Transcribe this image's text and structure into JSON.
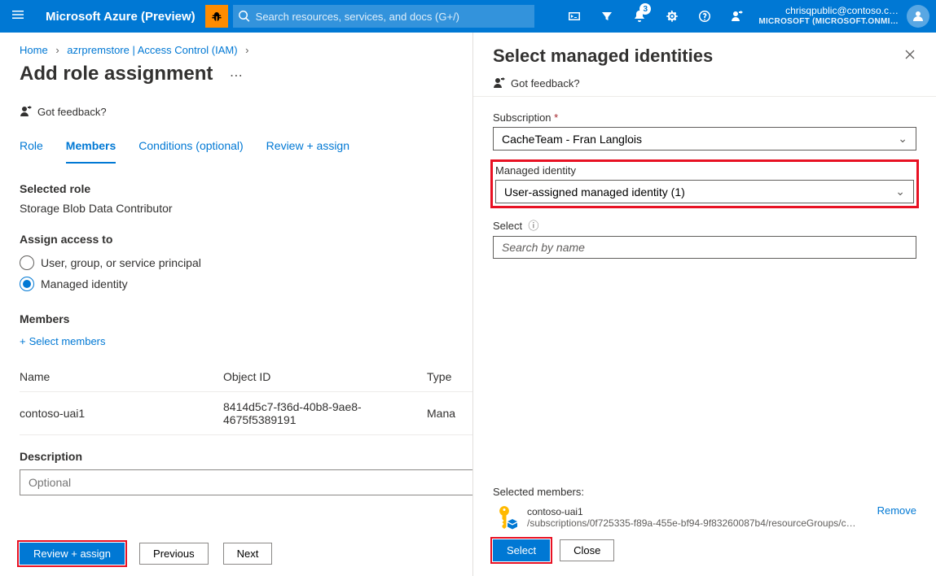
{
  "topbar": {
    "brand": "Microsoft Azure (Preview)",
    "search_placeholder": "Search resources, services, and docs (G+/)",
    "notification_count": "3",
    "user_email": "chrisqpublic@contoso.c…",
    "tenant": "MICROSOFT (MICROSOFT.ONMI…"
  },
  "breadcrumb": {
    "items": [
      "Home",
      "azrpremstore | Access Control (IAM)"
    ]
  },
  "page": {
    "title": "Add role assignment",
    "feedback": "Got feedback?"
  },
  "tabs": {
    "items": [
      {
        "label": "Role"
      },
      {
        "label": "Members"
      },
      {
        "label": "Conditions (optional)"
      },
      {
        "label": "Review + assign"
      }
    ],
    "active_index": 1
  },
  "selected_role": {
    "heading": "Selected role",
    "value": "Storage Blob Data Contributor"
  },
  "assign_access": {
    "heading": "Assign access to",
    "options": [
      {
        "label": "User, group, or service principal",
        "selected": false
      },
      {
        "label": "Managed identity",
        "selected": true
      }
    ]
  },
  "members": {
    "heading": "Members",
    "add_link": "Select members",
    "columns": [
      "Name",
      "Object ID",
      "Type"
    ],
    "rows": [
      {
        "name": "contoso-uai1",
        "object_id": "8414d5c7-f36d-40b8-9ae8-4675f5389191",
        "type": "Mana"
      }
    ]
  },
  "description": {
    "heading": "Description",
    "placeholder": "Optional"
  },
  "footer": {
    "primary": "Review + assign",
    "previous": "Previous",
    "next": "Next"
  },
  "panel": {
    "title": "Select managed identities",
    "feedback": "Got feedback?",
    "subscription_label": "Subscription",
    "subscription_value": "CacheTeam - Fran Langlois",
    "mi_label": "Managed identity",
    "mi_value": "User-assigned managed identity (1)",
    "select_label": "Select",
    "select_placeholder": "Search by name",
    "selected_heading": "Selected members:",
    "selected": {
      "name": "contoso-uai1",
      "path": "/subscriptions/0f725335-f89a-455e-bf94-9f83260087b4/resourceGroups/c…",
      "remove": "Remove"
    },
    "footer": {
      "select": "Select",
      "close": "Close"
    }
  }
}
